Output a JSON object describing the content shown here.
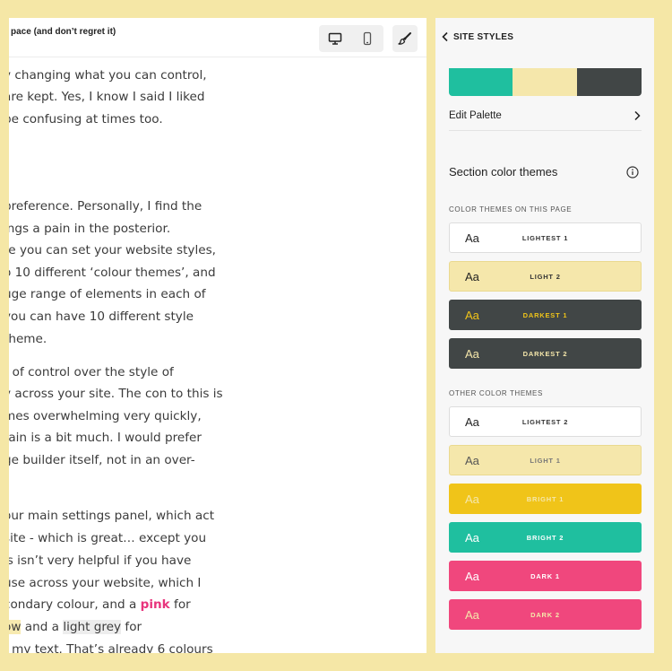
{
  "editor": {
    "title": "pace (and don’t regret it)",
    "article_lines": [
      {
        "parts": [
          {
            "text": "y changing what you can control,"
          }
        ]
      },
      {
        "parts": [
          {
            "text": " are kept. Yes, I know I said I liked"
          }
        ]
      },
      {
        "parts": [
          {
            "text": " be confusing at times too."
          }
        ]
      },
      {
        "parts": [
          {
            "text": "preference. Personally, I find the"
          }
        ]
      },
      {
        "parts": [
          {
            "text": "ings a pain in the posterior."
          }
        ]
      },
      {
        "parts": [
          {
            "text": "re you can set your website styles,"
          }
        ]
      },
      {
        "parts": [
          {
            "text": "o 10 different ‘colour themes’, and"
          }
        ]
      },
      {
        "parts": [
          {
            "text": "uge range of elements in each of"
          }
        ]
      },
      {
        "parts": [
          {
            "text": " you can have 10 different style"
          }
        ]
      },
      {
        "parts": [
          {
            "text": " theme."
          }
        ]
      },
      {
        "parts": [
          {
            "text": "t of control over the style of"
          }
        ]
      },
      {
        "parts": [
          {
            "text": "y across your site. The con to this is"
          }
        ]
      },
      {
        "parts": [
          {
            "text": "mes overwhelming very quickly,"
          }
        ]
      },
      {
        "parts": [
          {
            "text": "tain is a bit much. I would prefer"
          }
        ]
      },
      {
        "parts": [
          {
            "text": "ge builder itself, not in an over-"
          }
        ]
      },
      {
        "parts": [
          {
            "text": "our main settings panel, which act"
          }
        ]
      },
      {
        "parts": [
          {
            "text": "site - which is great… except you"
          }
        ]
      },
      {
        "parts": [
          {
            "text": "is isn’t very helpful if you have"
          }
        ]
      },
      {
        "parts": [
          {
            "text": "use across your website, which I"
          }
        ]
      },
      {
        "parts": [
          {
            "text": "condary colour, and a "
          },
          {
            "text": "pink",
            "style": "pink"
          },
          {
            "text": " for"
          }
        ]
      },
      {
        "parts": [
          {
            "text": "ow",
            "style": "hl-yellow"
          },
          {
            "text": " and a "
          },
          {
            "text": "light grey",
            "style": "hl-grey"
          },
          {
            "text": " for"
          }
        ]
      },
      {
        "parts": [
          {
            "text": "f my text. That’s already 6 colours"
          }
        ]
      }
    ]
  },
  "toolbar": {
    "desktop_icon": "desktop-icon",
    "mobile_icon": "mobile-icon",
    "design_icon": "paintbrush-icon"
  },
  "panel": {
    "title": "SITE STYLES",
    "palette_colors": [
      "#1fbf9f",
      "#f5e7ab",
      "#414646"
    ],
    "edit_palette_label": "Edit Palette",
    "section_heading": "Section color themes",
    "page_themes_label": "COLOR THEMES ON THIS PAGE",
    "other_themes_label": "OTHER COLOR THEMES",
    "page_themes": [
      {
        "aa": "Aa",
        "name": "LIGHTEST 1",
        "bg": "#ffffff",
        "aa_color": "#222222",
        "name_color": "#333333",
        "border": "#dddddd"
      },
      {
        "aa": "Aa",
        "name": "LIGHT 2",
        "bg": "#f5e7ab",
        "aa_color": "#222222",
        "name_color": "#333333",
        "border": "#ead98f"
      },
      {
        "aa": "Aa",
        "name": "DARKEST 1",
        "bg": "#414646",
        "aa_color": "#f0c419",
        "name_color": "#f0c419",
        "border": "#414646"
      },
      {
        "aa": "Aa",
        "name": "DARKEST 2",
        "bg": "#414646",
        "aa_color": "#f5e7ab",
        "name_color": "#f5e7ab",
        "border": "#414646"
      }
    ],
    "other_themes": [
      {
        "aa": "Aa",
        "name": "LIGHTEST 2",
        "bg": "#ffffff",
        "aa_color": "#222222",
        "name_color": "#333333",
        "border": "#dddddd"
      },
      {
        "aa": "Aa",
        "name": "LIGHT 1",
        "bg": "#f5e7ab",
        "aa_color": "#555555",
        "name_color": "#777777",
        "border": "#ead98f"
      },
      {
        "aa": "Aa",
        "name": "BRIGHT 1",
        "bg": "#f0c419",
        "aa_color": "#f5e7ab",
        "name_color": "#f5e7ab",
        "border": "#f0c419"
      },
      {
        "aa": "Aa",
        "name": "BRIGHT 2",
        "bg": "#1fbf9f",
        "aa_color": "#ffffff",
        "name_color": "#ffffff",
        "border": "#1fbf9f"
      },
      {
        "aa": "Aa",
        "name": "DARK 1",
        "bg": "#f0477d",
        "aa_color": "#ffffff",
        "name_color": "#ffffff",
        "border": "#f0477d"
      },
      {
        "aa": "Aa",
        "name": "DARK 2",
        "bg": "#f0477d",
        "aa_color": "#f5e7ab",
        "name_color": "#f5e7ab",
        "border": "#f0477d"
      }
    ]
  }
}
